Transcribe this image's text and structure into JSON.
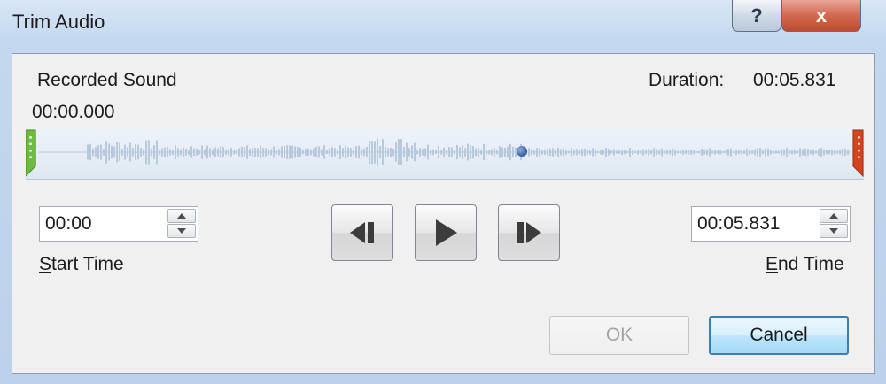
{
  "window": {
    "title": "Trim Audio",
    "help_label": "?",
    "close_label": "x"
  },
  "audio": {
    "name": "Recorded Sound",
    "duration_label": "Duration:",
    "duration_value": "00:05.831",
    "position": "00:00.000"
  },
  "start": {
    "value": "00:00",
    "label_first": "S",
    "label_rest": "tart Time"
  },
  "end": {
    "value": "00:05.831",
    "label_first": "E",
    "label_rest": "nd Time"
  },
  "buttons": {
    "ok": "OK",
    "cancel": "Cancel"
  },
  "colors": {
    "start_marker": "#6cbd3a",
    "end_marker": "#d3431e",
    "waveform": "#b9c9dc",
    "playhead": "#3d64a8"
  }
}
